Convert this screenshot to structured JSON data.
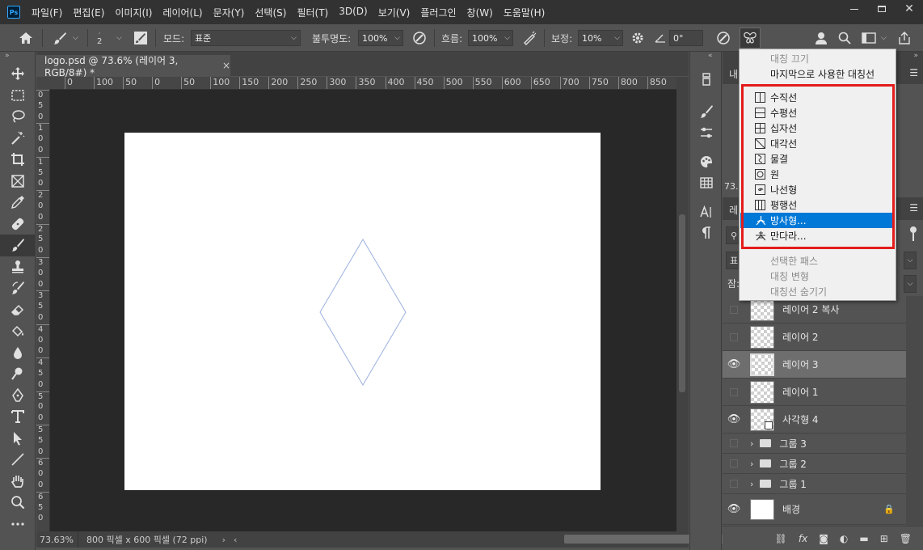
{
  "menubar": {
    "logo": "Ps",
    "items": [
      "파일(F)",
      "편집(E)",
      "이미지(I)",
      "레이어(L)",
      "문자(Y)",
      "선택(S)",
      "필터(T)",
      "3D(D)",
      "보기(V)",
      "플러그인",
      "창(W)",
      "도움말(H)"
    ]
  },
  "options": {
    "brush_size": "2",
    "mode_label": "모드:",
    "mode_value": "표준",
    "opacity_label": "불투명도:",
    "opacity_value": "100%",
    "flow_label": "흐름:",
    "flow_value": "100%",
    "smoothing_label": "보정:",
    "smoothing_value": "10%",
    "angle_value": "0°"
  },
  "document": {
    "tab_title": "logo.psd @ 73.6% (레이어 3, RGB/8#) *",
    "tab_close": "×",
    "ruler_h": [
      "0",
      "100",
      "50",
      "0",
      "50",
      "100",
      "150",
      "200",
      "250",
      "300",
      "350",
      "400",
      "450",
      "500",
      "550",
      "600",
      "650",
      "700",
      "750",
      "800",
      "850",
      "900"
    ],
    "ruler_v": [
      "0",
      "5",
      "0",
      "1",
      "0",
      "0",
      "1",
      "5",
      "0",
      "2",
      "0",
      "0",
      "2",
      "5",
      "0",
      "3",
      "0",
      "0",
      "3",
      "5",
      "0",
      "4",
      "0",
      "0",
      "4",
      "5",
      "0",
      "5",
      "0",
      "0",
      "5",
      "5",
      "0",
      "6",
      "0",
      "0",
      "6",
      "5",
      "0"
    ],
    "status_zoom": "73.63%",
    "status_info": "800 픽셀 x 600 픽셀 (72 ppi)"
  },
  "panel": {
    "top_tab": "내",
    "second_tab": "레",
    "zoom_short": "73.",
    "filter_label": "잠:",
    "mode_short": "표"
  },
  "layers": [
    {
      "name": "레이어 2 복사",
      "visible": false,
      "selected": false
    },
    {
      "name": "레이어 2",
      "visible": false,
      "selected": false
    },
    {
      "name": "레이어 3",
      "visible": true,
      "selected": true
    },
    {
      "name": "레이어 1",
      "visible": false,
      "selected": false
    },
    {
      "name": "사각형 4",
      "visible": true,
      "selected": false
    }
  ],
  "groups": [
    "그룹 3",
    "그룹 2",
    "그룹 1"
  ],
  "background_layer": "배경",
  "footer_fx": "fx",
  "dropdown": {
    "top_items": [
      "대칭 끄기",
      "마지막으로 사용한 대칭선"
    ],
    "symmetry_items": [
      "수직선",
      "수평선",
      "십자선",
      "대각선",
      "물결",
      "원",
      "나선형",
      "평행선",
      "방사형...",
      "만다라..."
    ],
    "bottom_items": [
      "선택한 패스",
      "대칭 변형",
      "대칭선 숨기기"
    ],
    "highlighted": "방사형..."
  },
  "colors": {
    "highlight": "#0078d7",
    "annotation_box": "#e41b1b",
    "diamond_stroke": "#9bb0e0"
  }
}
